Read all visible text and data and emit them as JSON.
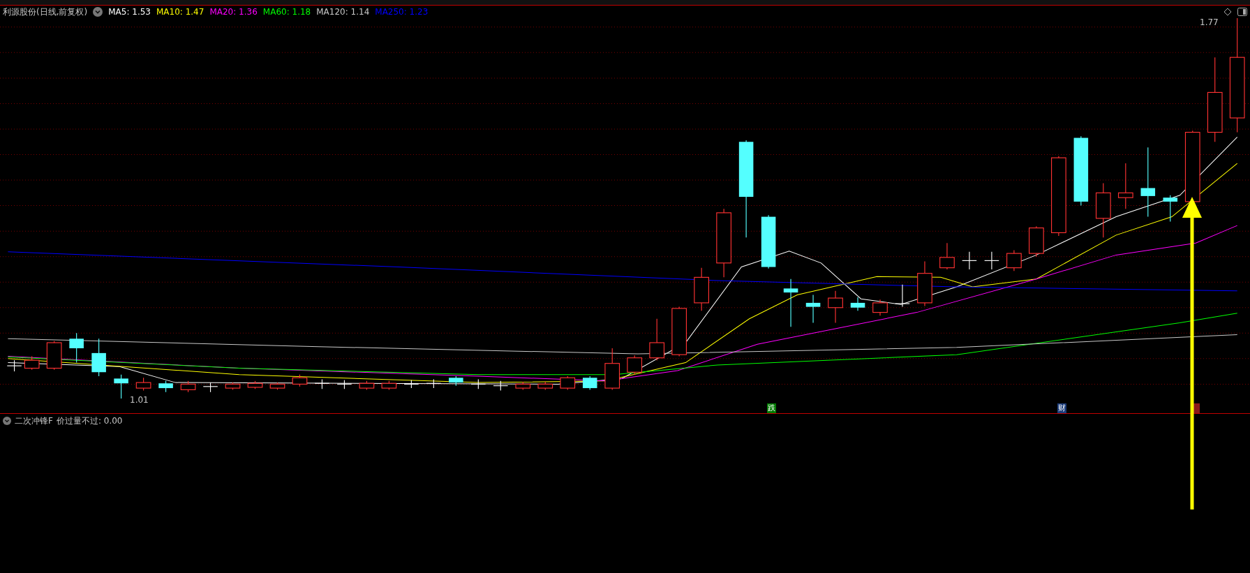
{
  "chart": {
    "title": "利源股份(日线,前复权)",
    "ma": [
      {
        "label": "MA5: 1.53",
        "color": "#ffffff"
      },
      {
        "label": "MA10: 1.47",
        "color": "#ffff00"
      },
      {
        "label": "MA20: 1.36",
        "color": "#ff00ff"
      },
      {
        "label": "MA60: 1.18",
        "color": "#00ff00"
      },
      {
        "label": "MA120: 1.14",
        "color": "#c8c8c8"
      },
      {
        "label": "MA250: 1.23",
        "color": "#0000ff"
      }
    ],
    "high_label": "1.77",
    "low_label": "1.01",
    "markers": [
      {
        "text": "跌",
        "color": "#007a00"
      },
      {
        "text": "财",
        "color": "#1c3d7a"
      },
      {
        "color": "#8a1a1a"
      }
    ]
  },
  "indicator": {
    "name": "二次冲锋F",
    "reading": "价过量不过: 0.00"
  }
}
